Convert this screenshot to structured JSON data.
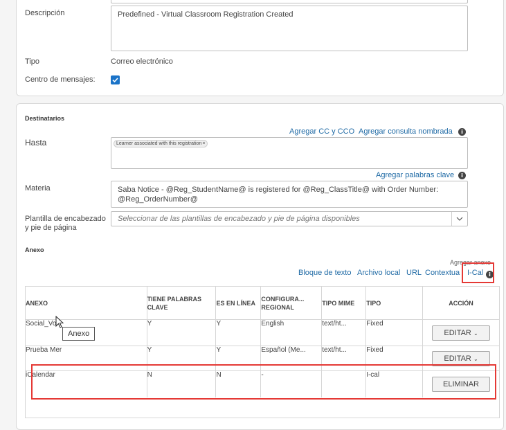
{
  "top": {
    "description_label": "Descripción",
    "description_value": "Predefined - Virtual Classroom Registration Created",
    "tipo_label": "Tipo",
    "tipo_value": "Correo electrónico",
    "message_center_label": "Centro de mensajes:",
    "message_center_checked": true
  },
  "recipients": {
    "section_title": "Destinatarios",
    "add_cc_link": "Agregar CC y CCO",
    "add_named_query_link": "Agregar consulta nombrada",
    "to_label": "Hasta",
    "to_chip": "Learner associated with this registration",
    "add_keywords_link": "Agregar palabras clave",
    "subject_label": "Materia",
    "subject_value": "Saba Notice - @Reg_StudentName@ is registered for @Reg_ClassTitle@ with Order Number: @Reg_OrderNumber@",
    "template_label": "Plantilla de encabezado y pie de página",
    "template_placeholder": "Seleccionar de las plantillas de encabezado y pie de página disponibles"
  },
  "attachments": {
    "section_title": "Anexo",
    "add_attachment_label": "Agregar anexo",
    "links": [
      "Bloque de texto",
      "Archivo local",
      "URL",
      "Contextua",
      "I-Cal"
    ],
    "tooltip": "Anexo",
    "columns": [
      "ANEXO",
      "TIENE PALABRAS CLAVE",
      "ES EN LÍNEA",
      "CONFIGURA... REGIONAL",
      "TIPO MIME",
      "TIPO",
      "ACCIÓN"
    ],
    "rows": [
      {
        "name": "Social_Vo",
        "keywords": "Y",
        "online": "Y",
        "regional": "English",
        "mime": "text/ht...",
        "type": "Fixed",
        "action": "EDITAR"
      },
      {
        "name": "Prueba Mer",
        "keywords": "Y",
        "online": "Y",
        "regional": "Español (Me...",
        "mime": "text/ht...",
        "type": "Fixed",
        "action": "EDITAR"
      },
      {
        "name": "iCalendar",
        "keywords": "N",
        "online": "N",
        "regional": "-",
        "mime": "",
        "type": "I-cal",
        "action": "ELIMINAR"
      }
    ]
  },
  "colors": {
    "link": "#1f6aa5",
    "checkbox": "#1a73c8",
    "highlight": "#e53935"
  }
}
